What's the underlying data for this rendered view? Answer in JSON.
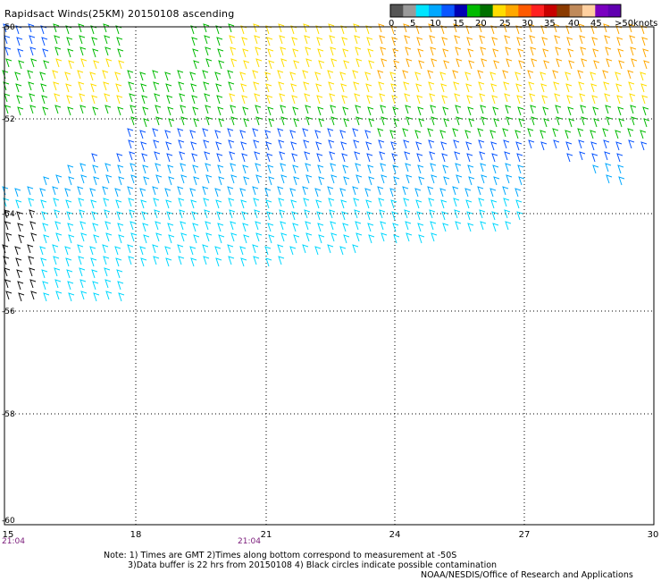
{
  "title": "Rapidsact Winds(25KM) 20150108 ascending",
  "color_scale": {
    "colors": [
      "#555555",
      "#9a9a9a",
      "#00e5ff",
      "#00a8ff",
      "#0a56ff",
      "#0000b4",
      "#00bb00",
      "#007000",
      "#ffdd00",
      "#ffa800",
      "#ff5a00",
      "#ff2020",
      "#c80000",
      "#8a3a00",
      "#c08a5a",
      "#ffd0a0",
      "#7a00c0",
      "#6000b0"
    ],
    "tick_labels": [
      "0",
      "5",
      "10",
      "15",
      "20",
      "25",
      "30",
      "35",
      "40",
      "45",
      ">50"
    ],
    "units": "knots"
  },
  "latitude_labels": [
    "-50",
    "-52",
    "-54",
    "-56",
    "-58",
    "-60"
  ],
  "longitude_labels": [
    "15",
    "18",
    "21",
    "24",
    "27",
    "30"
  ],
  "time_labels": [
    "21:04",
    "21:04"
  ],
  "notes": [
    "Note: 1) Times are GMT 2)Times along bottom correspond to measurement at -50S",
    "3)Data buffer is 22 hrs from 20150108 4) Black circles indicate possible contamination",
    "NOAA/NESDIS/Office of Research and Applications"
  ],
  "wind_field": {
    "description_free": true,
    "speed_units": "knots"
  }
}
